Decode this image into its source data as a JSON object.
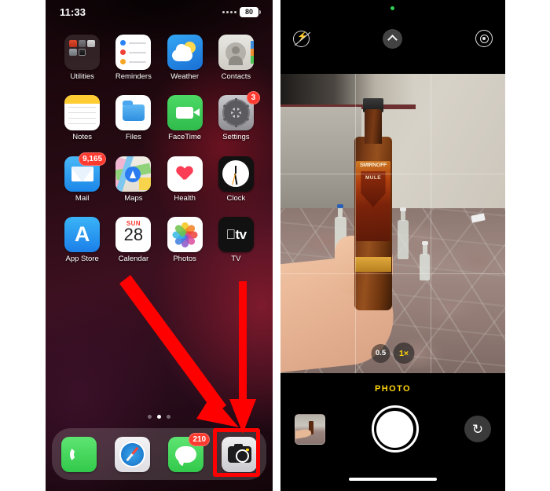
{
  "home_screen": {
    "status_bar": {
      "time": "11:33",
      "battery_level": "80",
      "signal_icon": "signal-dots-icon"
    },
    "apps": [
      {
        "label": "Utilities",
        "icon": "folder-icon",
        "badge": null
      },
      {
        "label": "Reminders",
        "icon": "reminders-icon",
        "badge": null
      },
      {
        "label": "Weather",
        "icon": "weather-icon",
        "badge": null
      },
      {
        "label": "Contacts",
        "icon": "contacts-icon",
        "badge": null
      },
      {
        "label": "Notes",
        "icon": "notes-icon",
        "badge": null
      },
      {
        "label": "Files",
        "icon": "files-icon",
        "badge": null
      },
      {
        "label": "FaceTime",
        "icon": "facetime-icon",
        "badge": null
      },
      {
        "label": "Settings",
        "icon": "settings-icon",
        "badge": "3"
      },
      {
        "label": "Mail",
        "icon": "mail-icon",
        "badge": "9,165"
      },
      {
        "label": "Maps",
        "icon": "maps-icon",
        "badge": null
      },
      {
        "label": "Health",
        "icon": "health-icon",
        "badge": null
      },
      {
        "label": "Clock",
        "icon": "clock-icon",
        "badge": null
      },
      {
        "label": "App Store",
        "icon": "app-store-icon",
        "badge": null
      },
      {
        "label": "Calendar",
        "icon": "calendar-icon",
        "badge": null
      },
      {
        "label": "Photos",
        "icon": "photos-icon",
        "badge": null
      },
      {
        "label": "TV",
        "icon": "tv-icon",
        "badge": null
      }
    ],
    "calendar_icon": {
      "weekday": "SUN",
      "day": "28"
    },
    "app_store_glyph": "A",
    "tv_glyph": "\u0000tv",
    "page_dots": {
      "count": 3,
      "active_index": 1
    },
    "dock": [
      {
        "label": "Phone",
        "icon": "phone-icon",
        "badge": null
      },
      {
        "label": "Safari",
        "icon": "safari-icon",
        "badge": null
      },
      {
        "label": "Messages",
        "icon": "messages-icon",
        "badge": "210"
      },
      {
        "label": "Camera",
        "icon": "camera-icon",
        "badge": null,
        "highlighted": true
      }
    ],
    "annotations": {
      "highlight_color": "#ff0000",
      "arrow_count": 2,
      "arrow_target": "camera-icon"
    }
  },
  "camera_app": {
    "top_controls": {
      "flash": "flash-off-icon",
      "expand": "chevron-up-icon",
      "live_photo": "live-photo-icon",
      "privacy_indicator": "green-recording-dot"
    },
    "viewfinder": {
      "grid_enabled": true,
      "subject": "hand holding Smirnoff Mule bottle",
      "bottle_brand": "SMIRNOFF",
      "bottle_variant": "MULE"
    },
    "zoom_options": [
      {
        "label": "0.5",
        "selected": false
      },
      {
        "label": "1×",
        "selected": true
      }
    ],
    "mode_label": "PHOTO",
    "bottom_controls": {
      "thumbnail": "last-photo-thumbnail",
      "shutter": "shutter-button",
      "flip": "flip-camera-icon",
      "flip_glyph": "↻"
    }
  },
  "colors": {
    "accent_yellow": "#ffd60a",
    "badge_red": "#ff3b30",
    "annotation_red": "#ff0000",
    "privacy_green": "#30d158"
  }
}
